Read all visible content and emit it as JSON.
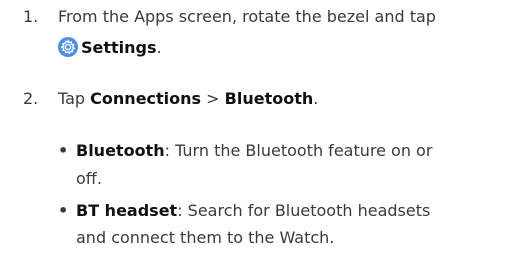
{
  "steps": [
    {
      "number": "1.",
      "line1": "From the Apps screen, rotate the bezel and tap",
      "icon": "settings-gear-icon",
      "icon_color": "#4a8ee6",
      "bold_label": "Settings",
      "end_text": "."
    },
    {
      "number": "2.",
      "prefix": "Tap ",
      "bold1": "Connections",
      "sep": " > ",
      "bold2": "Bluetooth",
      "end_text": "."
    }
  ],
  "bullets": [
    {
      "symbol": "•",
      "bold": "Bluetooth",
      "line1_rest": ": Turn the Bluetooth feature on or",
      "line2": "off."
    },
    {
      "symbol": "•",
      "bold": "BT headset",
      "line1_rest": ": Search for Bluetooth headsets",
      "line2": "and connect them to the Watch."
    }
  ]
}
